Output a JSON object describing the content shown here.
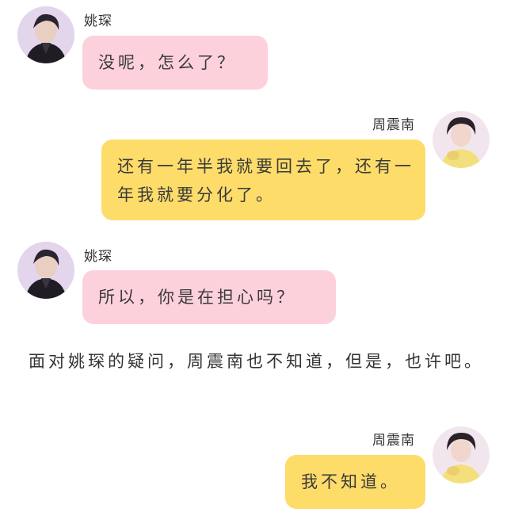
{
  "messages": [
    {
      "sender": "姚琛",
      "text": "没呢，怎么了？",
      "side": "left",
      "bubble_color": "#fdd1dc"
    },
    {
      "sender": "周震南",
      "text": "还有一年半我就要回去了，还有一年我就要分化了。",
      "side": "right",
      "bubble_color": "#fddc6a"
    },
    {
      "sender": "姚琛",
      "text": "所以，你是在担心吗？",
      "side": "left",
      "bubble_color": "#fdd1dc"
    },
    {
      "sender": "周震南",
      "text": "我不知道。",
      "side": "right",
      "bubble_color": "#fddc6a"
    }
  ],
  "narration": "面对姚琛的疑问，周震南也不知道，但是，也许吧。"
}
